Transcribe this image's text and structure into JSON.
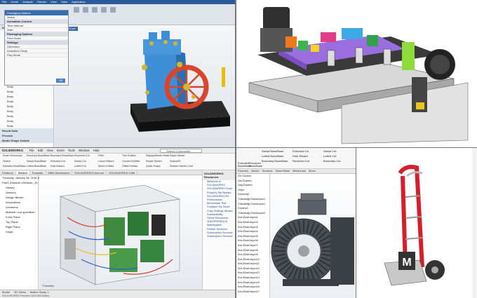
{
  "nx": {
    "ribbon": [
      "File",
      "Home",
      "Analysis",
      "Render",
      "View",
      "Tools",
      "Application"
    ],
    "dialog_title": "Packaging Options",
    "dialog_rows": [
      "Select",
      "Animation Control",
      "Time Interval",
      "Start",
      "Packaging Options",
      "Pixel Scale",
      "Settings",
      "Deformed",
      "Animation Delay",
      "Play Mode"
    ],
    "ok_label": "OK",
    "view_tab": "_model1.prt",
    "nav_rows": [
      "Name",
      "Body",
      "Body",
      "Body",
      "Body",
      "Body",
      "Body",
      "Body",
      "Body",
      "Body",
      "Body",
      "Body",
      "Body",
      "Body",
      "Body",
      "Body",
      "Body",
      "Body",
      "Body",
      "Body",
      "Body"
    ],
    "nav_bottom": [
      "Result Data",
      "Preview",
      "Model Shape Details"
    ]
  },
  "sw_electrical": {
    "logo": "SOLIDWORKS",
    "menu": [
      "File",
      "Edit",
      "View",
      "Insert",
      "Tools",
      "Window",
      "Help"
    ],
    "search": "Search Commands",
    "ribbon_buttons": [
      "Smart Dimension",
      "Sketch",
      "Extruded Boss/Base",
      "Revolved Boss/Base",
      "Swept Boss/Base",
      "Lofted Boss/Base",
      "Boundary Boss/Base",
      "Extruded Cut",
      "Hole Wizard",
      "Revolved Cut",
      "Swept Cut",
      "Lofted Cut",
      "Fillet",
      "Linear Pattern",
      "Mirror Entities",
      "Trim Entities",
      "Convert Entities",
      "Offset Entities",
      "Display/Delete Relations",
      "Repair Sketch",
      "Quick Snaps",
      "Rapid Sketch",
      "Instant2D",
      "Shaded Sketch Contours"
    ],
    "tabs": [
      "Features",
      "Sketch",
      "Evaluate",
      "MBD Dimensions",
      "SOLIDWORKS Add-Ins",
      "SOLIDWORKS CAM"
    ],
    "active_tab": "Sketch",
    "tree": [
      "Thursday, January 28, 2016 9:42:16 AM GMT",
      "Part1 (Default<<Default>_Di",
      "History",
      "Sensors",
      "Design Binder",
      "Annotations",
      "Lineforms",
      "Material <not specified>",
      "Front Plane",
      "Top Plane",
      "Right Plane",
      "Origin"
    ],
    "side_title": "SOLIDWORKS Resources",
    "side_items": [
      "Welcome to SOLIDWORKS",
      "SOLIDWORKS Tools",
      "Property Tab Builder",
      "SOLIDWORKS Rx",
      "Performance Benchmark Test",
      "Compare My Score",
      "Copy Settings Wizard",
      "Sustainability",
      "Online Resources",
      "3DEXPERIENCE Marketplace",
      "Partner Solutions",
      "Subscription Services",
      "Subscription Services"
    ],
    "view_label": "*Trimetric",
    "bottom_tabs": [
      "Model",
      "3D Views",
      "Motion Study 1"
    ],
    "status": "SOLIDWORKS Premium 2016 x64 Edition"
  },
  "sw_motor": {
    "buttons": [
      "Swept Boss/Base",
      "Lofted Boss/Base",
      "Boundary Boss/Base",
      "Extruded Cut",
      "Hole Wizard",
      "Revolved Cut",
      "Swept Cut",
      "Lofted Cut",
      "Boundary Cut"
    ],
    "left_buttons": [
      "Extruded Boss/Base",
      "Revolved Boss/Base"
    ],
    "tabs": [
      "Features",
      "Sketch",
      "Surfaces",
      "Sheet Metal",
      "Weldments",
      "Direct Editing",
      "Markup",
      "Evaluate",
      "PRO"
    ],
    "tree": [
      "Ön Düzlem",
      "Üst Düzlem",
      "Sağ Düzlem",
      "Orijin",
      "Düzenej2",
      "Yüksekliği-Ekstrüzyon1",
      "Yüksekliği-Ekstrüzyon1",
      "Düzlem1",
      "Yüksekliği-Ekstrüzyon2",
      "Kes-Ekstrüzyon1",
      "Kes-Ekstrüzyon2",
      "Kes-Ekstrüzyon3",
      "Kes-Ekstrüzyon4",
      "Kes-Ekstrüzyon5",
      "Kes-Ekstrüzyon6",
      "Kes-Ekstrüzyon7",
      "Kes-Ekstrüzyon8",
      "Kes-Ekstrüzyon9",
      "Kes-Ekstrüzyon10",
      "Kes-Ekstrüzyon11",
      "Kes-Ekstrüzyon12",
      "Kes-Ekstrüzyon13",
      "Kes-Ekstrüzyon14",
      "Kes-Ekstrüzyon15",
      "Kes-Ekstrüzyon16",
      "Kes-Ekstrüzyon17"
    ]
  },
  "trolley": {
    "plate_letter": "M"
  },
  "colors": {
    "nx_blue": "#3a6db0",
    "sw_red": "#c0161d",
    "engine_blue": "#3f8fd6",
    "flywheel_red": "#d9442c",
    "trolley_red": "#d4202a"
  }
}
